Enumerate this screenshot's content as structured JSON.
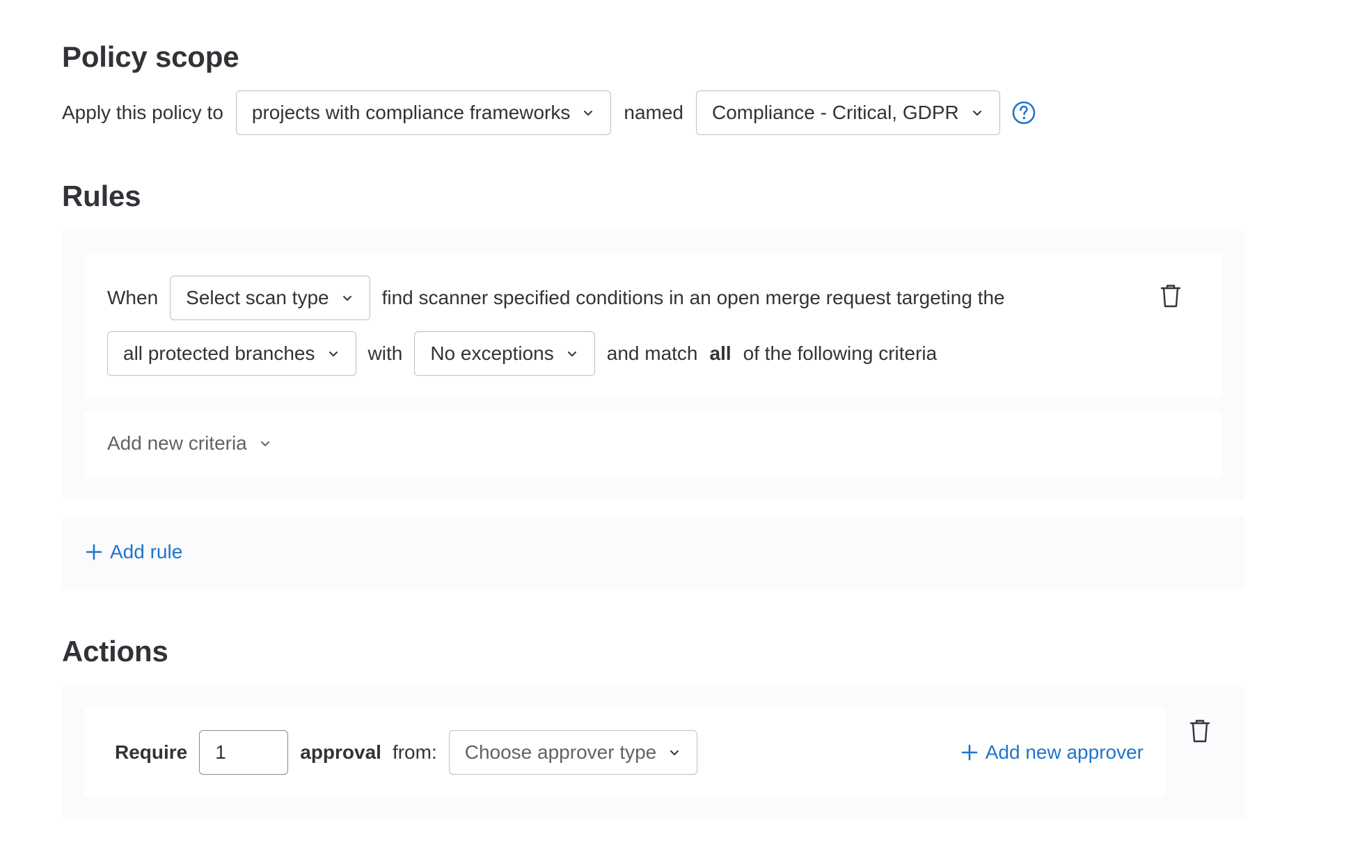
{
  "scope": {
    "title": "Policy scope",
    "apply_label": "Apply this policy to",
    "apply_value": "projects with compliance frameworks",
    "named_label": "named",
    "named_value": "Compliance - Critical, GDPR",
    "help_icon": "question-circle-icon"
  },
  "rules": {
    "title": "Rules",
    "when_label": "When",
    "scan_type_value": "Select scan type",
    "condition_text": "find scanner specified conditions in an open merge request targeting the",
    "branches_value": "all protected branches",
    "with_label": "with",
    "exceptions_value": "No exceptions",
    "match_prefix": "and match",
    "match_value": "all",
    "match_suffix": "of the following criteria",
    "add_criteria_label": "Add new criteria",
    "add_rule_label": "Add rule"
  },
  "actions": {
    "title": "Actions",
    "require_label": "Require",
    "approvals_count": "1",
    "approval_label": "approval",
    "from_label": "from:",
    "approver_type_placeholder": "Choose approver type",
    "add_approver_label": "Add new approver"
  },
  "colors": {
    "link": "#1f75cb",
    "panel_bg": "#fbfafd",
    "border": "#bfbfc3",
    "text": "#333238"
  }
}
